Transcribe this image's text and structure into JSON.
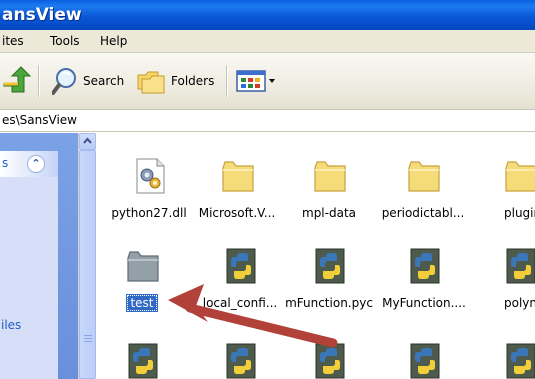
{
  "window": {
    "title": "ansView"
  },
  "menubar": {
    "items": [
      "ites",
      "Tools",
      "Help"
    ]
  },
  "toolbar": {
    "search_label": "Search",
    "folders_label": "Folders"
  },
  "address": {
    "path": "es\\SansView"
  },
  "tasks": {
    "header_text": "s",
    "link_text": "iles"
  },
  "files": {
    "row1": [
      {
        "name": "python27.dll",
        "icon": "dll-icon"
      },
      {
        "name": "Microsoft.V...",
        "icon": "folder-icon"
      },
      {
        "name": "mpl-data",
        "icon": "folder-icon"
      },
      {
        "name": "periodictabl...",
        "icon": "folder-icon"
      },
      {
        "name": "plugin_mo",
        "icon": "folder-icon"
      }
    ],
    "row2": [
      {
        "name": "test",
        "icon": "folder-gray-icon",
        "selected": true
      },
      {
        "name": "local_confi...",
        "icon": "python-file-icon"
      },
      {
        "name": "mFunction.pyc",
        "icon": "python-file-icon"
      },
      {
        "name": "MyFunction....",
        "icon": "python-file-icon"
      },
      {
        "name": "polynomin",
        "icon": "python-file-icon"
      }
    ],
    "row3_icon": "python-file-icon"
  },
  "colors": {
    "titlebar": "#0a58d8",
    "selection": "#316ac5",
    "annotation_arrow": "#b2413a"
  }
}
